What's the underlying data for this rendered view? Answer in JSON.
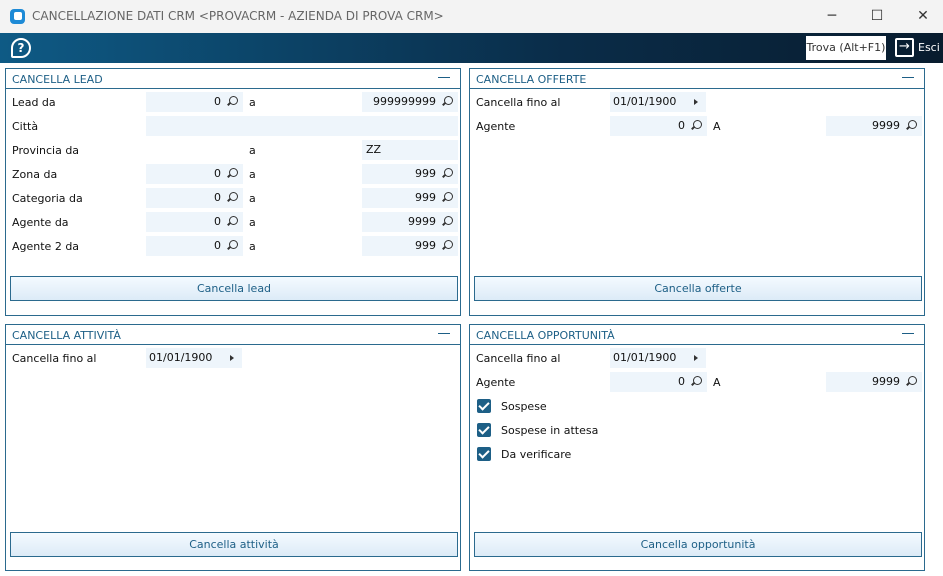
{
  "window": {
    "title": "CANCELLAZIONE DATI CRM <PROVACRM - AZIENDA DI PROVA CRM>",
    "minimize": "─",
    "maximize": "☐",
    "close": "✕"
  },
  "toolbar": {
    "help": "?",
    "find": "Trova (Alt+F1)",
    "exit": "Esci",
    "exit_icon": "→"
  },
  "lead": {
    "title": "CANCELLA LEAD",
    "sep": "a",
    "rows": [
      {
        "label": "Lead da",
        "from": "0",
        "to": "999999999"
      },
      {
        "label": "Città",
        "value": ""
      },
      {
        "label": "Provincia da",
        "from": "",
        "to": "ZZ"
      },
      {
        "label": "Zona da",
        "from": "0",
        "to": "999"
      },
      {
        "label": "Categoria da",
        "from": "0",
        "to": "999"
      },
      {
        "label": "Agente da",
        "from": "0",
        "to": "9999"
      },
      {
        "label": "Agente 2  da",
        "from": "0",
        "to": "999"
      }
    ],
    "button": "Cancella lead"
  },
  "offerte": {
    "title": "CANCELLA OFFERTE",
    "date_label": "Cancella fino al",
    "date": "01/01/1900",
    "agent_label": "Agente",
    "agent_from": "0",
    "sep": "A",
    "agent_to": "9999",
    "button": "Cancella offerte"
  },
  "attivita": {
    "title": "CANCELLA ATTIVITÀ",
    "date_label": "Cancella fino al",
    "date": "01/01/1900",
    "button": "Cancella attività"
  },
  "opportunita": {
    "title": "CANCELLA OPPORTUNITÀ",
    "date_label": "Cancella fino al",
    "date": "01/01/1900",
    "agent_label": "Agente",
    "agent_from": "0",
    "sep": "A",
    "agent_to": "9999",
    "checks": [
      {
        "label": "Sospese",
        "checked": true
      },
      {
        "label": "Sospese in attesa",
        "checked": true
      },
      {
        "label": "Da verificare",
        "checked": true
      }
    ],
    "button": "Cancella opportunità"
  }
}
